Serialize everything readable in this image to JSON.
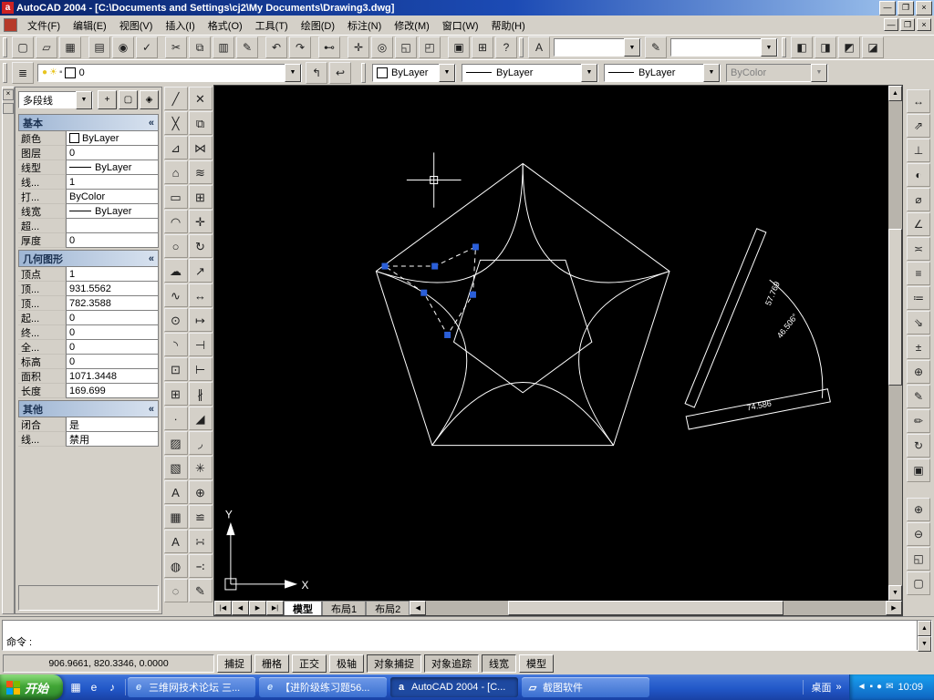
{
  "window": {
    "title": "AutoCAD 2004 - [C:\\Documents and Settings\\cj2\\My Documents\\Drawing3.dwg]",
    "app_icon_letter": "a"
  },
  "icons": {
    "minimize": "—",
    "restore": "❐",
    "close": "×",
    "dropdown": "▼",
    "up": "▲",
    "down": "▼",
    "left": "◀",
    "right": "▶",
    "collapse": "«",
    "bulb": "●",
    "sun": "☀",
    "lock": "▪",
    "desktop_chevron": "»"
  },
  "menu": {
    "items": [
      "文件(F)",
      "编辑(E)",
      "视图(V)",
      "插入(I)",
      "格式(O)",
      "工具(T)",
      "绘图(D)",
      "标注(N)",
      "修改(M)",
      "窗口(W)",
      "帮助(H)"
    ]
  },
  "toolbar1": {
    "buttons": [
      {
        "name": "new",
        "glyph": "▢"
      },
      {
        "name": "open",
        "glyph": "▱"
      },
      {
        "name": "save",
        "glyph": "▦"
      },
      {
        "name": "plot",
        "glyph": "▤",
        "gap": true
      },
      {
        "name": "plot-preview",
        "glyph": "◉"
      },
      {
        "name": "spelling",
        "glyph": "✓"
      },
      {
        "name": "cut",
        "glyph": "✂",
        "gap": true
      },
      {
        "name": "copy",
        "glyph": "⧉"
      },
      {
        "name": "paste",
        "glyph": "▥"
      },
      {
        "name": "match-properties",
        "glyph": "✎"
      },
      {
        "name": "undo",
        "glyph": "↶",
        "gap": true
      },
      {
        "name": "redo",
        "glyph": "↷"
      },
      {
        "name": "insert-hyperlink",
        "glyph": "⊷",
        "gap": true
      },
      {
        "name": "pan-realtime",
        "glyph": "✛",
        "gap": true
      },
      {
        "name": "zoom-realtime",
        "glyph": "◎"
      },
      {
        "name": "zoom-window",
        "glyph": "◱"
      },
      {
        "name": "zoom-previous",
        "glyph": "◰"
      },
      {
        "name": "properties",
        "glyph": "▣",
        "gap": true
      },
      {
        "name": "designcenter",
        "glyph": "⊞"
      },
      {
        "name": "help",
        "glyph": "?"
      }
    ],
    "text_style_button": "A",
    "style_combo1": "",
    "dim_style_button": "✎",
    "style_combo2": "",
    "right_buttons": [
      {
        "name": "toolbar-osnap",
        "glyph": "◧"
      },
      {
        "name": "toolbar-ucs",
        "glyph": "◨"
      },
      {
        "name": "toolbar-view",
        "glyph": "◩"
      },
      {
        "name": "toolbar-render",
        "glyph": "◪"
      }
    ]
  },
  "toolbar2": {
    "layers_button": "≣",
    "layer_combo": {
      "value": "0"
    },
    "make_current_button": "↰",
    "layer_previous_button": "↩",
    "color_combo": {
      "value": "ByLayer"
    },
    "linetype_combo": {
      "value": "ByLayer"
    },
    "lineweight_combo": {
      "value": "ByLayer"
    },
    "plotstyle_combo": {
      "value": "ByColor"
    }
  },
  "draw_toolbar": [
    {
      "name": "line",
      "glyph": "╱"
    },
    {
      "name": "construction-line",
      "glyph": "╳"
    },
    {
      "name": "polyline",
      "glyph": "⊿"
    },
    {
      "name": "polygon",
      "glyph": "⌂"
    },
    {
      "name": "rectangle",
      "glyph": "▭"
    },
    {
      "name": "arc",
      "glyph": "◠"
    },
    {
      "name": "circle",
      "glyph": "○"
    },
    {
      "name": "revision-cloud",
      "glyph": "☁"
    },
    {
      "name": "spline",
      "glyph": "∿"
    },
    {
      "name": "ellipse",
      "glyph": "⊙"
    },
    {
      "name": "ellipse-arc",
      "glyph": "◝"
    },
    {
      "name": "insert-block",
      "glyph": "⊡"
    },
    {
      "name": "make-block",
      "glyph": "⊞"
    },
    {
      "name": "point",
      "glyph": "∙"
    },
    {
      "name": "hatch",
      "glyph": "▨"
    },
    {
      "name": "region",
      "glyph": "▧"
    },
    {
      "name": "mtext",
      "glyph": "A"
    },
    {
      "name": "table",
      "glyph": "▦"
    },
    {
      "name": "single-line-text",
      "glyph": "A"
    },
    {
      "name": "donut",
      "glyph": "◍"
    },
    {
      "name": "boundary",
      "glyph": "◌"
    }
  ],
  "modify_toolbar": [
    {
      "name": "erase",
      "glyph": "✕"
    },
    {
      "name": "copy-object",
      "glyph": "⧉"
    },
    {
      "name": "mirror",
      "glyph": "⋈"
    },
    {
      "name": "offset",
      "glyph": "≋"
    },
    {
      "name": "array",
      "glyph": "⊞"
    },
    {
      "name": "move",
      "glyph": "✛"
    },
    {
      "name": "rotate",
      "glyph": "↻"
    },
    {
      "name": "scale",
      "glyph": "↗"
    },
    {
      "name": "stretch",
      "glyph": "↔"
    },
    {
      "name": "lengthen",
      "glyph": "↦"
    },
    {
      "name": "trim",
      "glyph": "⊣"
    },
    {
      "name": "extend",
      "glyph": "⊢"
    },
    {
      "name": "break",
      "glyph": "∦"
    },
    {
      "name": "chamfer",
      "glyph": "◢"
    },
    {
      "name": "fillet",
      "glyph": "◞"
    },
    {
      "name": "explode",
      "glyph": "✳"
    },
    {
      "name": "join",
      "glyph": "⊕"
    },
    {
      "name": "align",
      "glyph": "≌"
    },
    {
      "name": "divide",
      "glyph": "∺"
    },
    {
      "name": "measure",
      "glyph": "∹"
    },
    {
      "name": "edit-polyline",
      "glyph": "✎"
    }
  ],
  "dim_toolbar": [
    {
      "name": "dim-linear",
      "glyph": "↔"
    },
    {
      "name": "dim-aligned",
      "glyph": "⇗"
    },
    {
      "name": "dim-ordinate",
      "glyph": "⊥"
    },
    {
      "name": "dim-radius",
      "glyph": "◐"
    },
    {
      "name": "dim-diameter",
      "glyph": "⌀"
    },
    {
      "name": "dim-angular",
      "glyph": "∠"
    },
    {
      "name": "quick-dim",
      "glyph": "≍"
    },
    {
      "name": "dim-baseline",
      "glyph": "≡"
    },
    {
      "name": "dim-continue",
      "glyph": "≔"
    },
    {
      "name": "quick-leader",
      "glyph": "⇘"
    },
    {
      "name": "tolerance",
      "glyph": "±"
    },
    {
      "name": "center-mark",
      "glyph": "⊕"
    },
    {
      "name": "dim-edit",
      "glyph": "✎"
    },
    {
      "name": "dim-text-edit",
      "glyph": "✏"
    },
    {
      "name": "dim-update",
      "glyph": "↻"
    },
    {
      "name": "dim-style",
      "glyph": "▣"
    }
  ],
  "nav_toolbar": [
    {
      "name": "zoom-in",
      "glyph": "⊕"
    },
    {
      "name": "zoom-out",
      "glyph": "⊖"
    },
    {
      "name": "zoom-extents",
      "glyph": "◱"
    },
    {
      "name": "zoom-all",
      "glyph": "▢"
    }
  ],
  "palette": {
    "selector_value": "多段线",
    "buttons": [
      {
        "name": "toggle-pickadd-button",
        "glyph": "+"
      },
      {
        "name": "select-objects-button",
        "glyph": "▢"
      },
      {
        "name": "quick-select-button",
        "glyph": "◈"
      }
    ],
    "sections": {
      "basic": {
        "title": "基本",
        "rows": [
          {
            "label": "颜色",
            "value": "ByLayer",
            "swatch_color": true
          },
          {
            "label": "图层",
            "value": "0"
          },
          {
            "label": "线型",
            "value": "ByLayer",
            "swatch_line": true
          },
          {
            "label": "线...",
            "value": "1"
          },
          {
            "label": "打...",
            "value": "ByColor"
          },
          {
            "label": "线宽",
            "value": "ByLayer",
            "swatch_line": true
          },
          {
            "label": "超...",
            "value": ""
          },
          {
            "label": "厚度",
            "value": "0"
          }
        ]
      },
      "geometry": {
        "title": "几何图形",
        "rows": [
          {
            "label": "顶点",
            "value": "1"
          },
          {
            "label": "顶...",
            "value": "931.5562"
          },
          {
            "label": "顶...",
            "value": "782.3588"
          },
          {
            "label": "起...",
            "value": "0"
          },
          {
            "label": "终...",
            "value": "0"
          },
          {
            "label": "全...",
            "value": "0"
          },
          {
            "label": "标高",
            "value": "0"
          },
          {
            "label": "面积",
            "value": "1071.3448"
          },
          {
            "label": "长度",
            "value": "169.699"
          }
        ]
      },
      "other": {
        "title": "其他",
        "rows": [
          {
            "label": "闭合",
            "value": "是"
          },
          {
            "label": "线...",
            "value": "禁用"
          }
        ]
      }
    }
  },
  "canvas": {
    "dim_texts": [
      "57.769",
      "46.506°",
      "74.586"
    ],
    "axis_x": "X",
    "axis_y": "Y",
    "tabs": [
      {
        "label": "模型",
        "active": true
      },
      {
        "label": "布局1"
      },
      {
        "label": "布局2"
      }
    ],
    "tab_nav": [
      "|◀",
      "◀",
      "▶",
      "▶|"
    ]
  },
  "command": {
    "history": [
      ""
    ],
    "prompt": "命令 :"
  },
  "status": {
    "coords": "906.9661, 820.3346, 0.0000",
    "toggles": [
      {
        "label": "捕捉"
      },
      {
        "label": "栅格"
      },
      {
        "label": "正交"
      },
      {
        "label": "极轴"
      },
      {
        "label": "对象捕捉",
        "pressed": true
      },
      {
        "label": "对象追踪",
        "pressed": true
      },
      {
        "label": "线宽",
        "pressed": true
      },
      {
        "label": "模型"
      }
    ]
  },
  "taskbar": {
    "start_label": "开始",
    "quick_launch": [
      {
        "name": "show-desktop-icon",
        "glyph": "▦"
      },
      {
        "name": "ie-quicklaunch-icon",
        "glyph": "e"
      },
      {
        "name": "media-player-icon",
        "glyph": "♪"
      }
    ],
    "tasks": [
      {
        "label": "三维网技术论坛 三...",
        "icon": "e",
        "is_ie": true
      },
      {
        "label": "【进阶级练习题56...",
        "icon": "e",
        "is_ie": true
      },
      {
        "label": "AutoCAD 2004 - [C...",
        "icon": "a",
        "is_acad": true,
        "active": true
      },
      {
        "label": "截图软件",
        "icon": "▱",
        "is_folder": true
      }
    ],
    "desktop_label": "桌面",
    "tray_icons": [
      {
        "name": "volume-icon",
        "glyph": "◄"
      },
      {
        "name": "network-icon",
        "glyph": "▪"
      },
      {
        "name": "antivirus-icon",
        "glyph": "●"
      },
      {
        "name": "message-icon",
        "glyph": "✉"
      }
    ],
    "time": "10:09"
  }
}
